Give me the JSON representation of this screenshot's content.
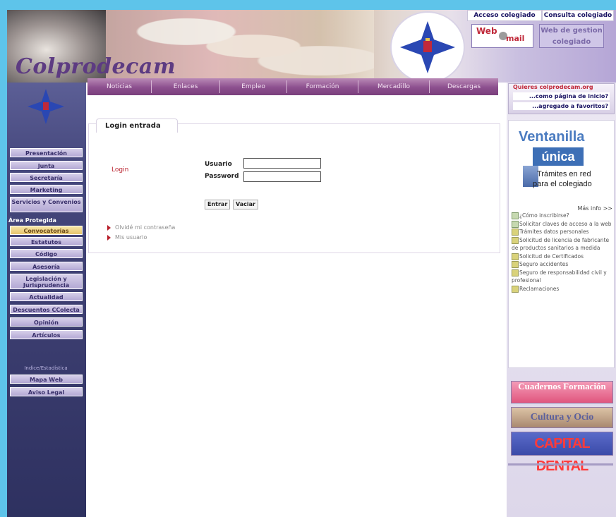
{
  "header": {
    "logo_text": "Colprodecam",
    "top_links": [
      "Acceso colegiado",
      "Consulta colegiado"
    ],
    "webmail": {
      "line1": "Web",
      "line2": "mail"
    },
    "webchat": [
      "Web de gestion",
      "colegiado"
    ]
  },
  "sidebar": {
    "items_top": [
      "Presentación",
      "Junta",
      "Secretaría",
      "Marketing",
      "Servicios y Convenios"
    ],
    "area_label": "Área Protegida",
    "items_protected": [
      "Convocatorias",
      "Estatutos",
      "Código",
      "Asesoría",
      "Legislación y Jurisprudencia",
      "Actualidad",
      "Descuentos CColecta",
      "Opinión",
      "Artículos"
    ],
    "pagerank": "Indice/Estadística",
    "items_bottom": [
      "Mapa Web",
      "Aviso Legal"
    ]
  },
  "topnav": [
    "Noticias",
    "Enlaces",
    "Empleo",
    "Formación",
    "Mercadillo",
    "Descargas"
  ],
  "main": {
    "tab_label": "Login entrada",
    "login_label": "Login",
    "usuario_label": "Usuario",
    "password_label": "Password",
    "usuario_value": "",
    "password_value": "",
    "enter_button": "Entrar",
    "clear_button": "Vaciar",
    "links": [
      "Olvidé mi contraseña",
      "Mis usuario"
    ]
  },
  "right": {
    "promo_top": "Quieres colprodecam.org",
    "promo_home": "...como página de inicio?",
    "promo_fav": "...agregado a favoritos?",
    "ventanilla_title": "Ventanilla",
    "ventanilla_unica": "única",
    "ventanilla_sub1": "Trámites en red",
    "ventanilla_sub2": "para el colegiado",
    "more_info": "Más info >>",
    "items": [
      "¿Cómo inscribirse?",
      "Solicitar claves de acceso a la web",
      "Trámites datos personales",
      "Solicitud de licencia de fabricante de productos sanitarios a medida",
      "Solicitud de Certificados",
      "Seguro accidentes",
      "Seguro de responsabilidad civil y profesional",
      "Reclamaciones"
    ],
    "banners": [
      "Cuadernos Formación",
      "Cultura y Ocio",
      "CAPITAL DENTAL"
    ]
  }
}
